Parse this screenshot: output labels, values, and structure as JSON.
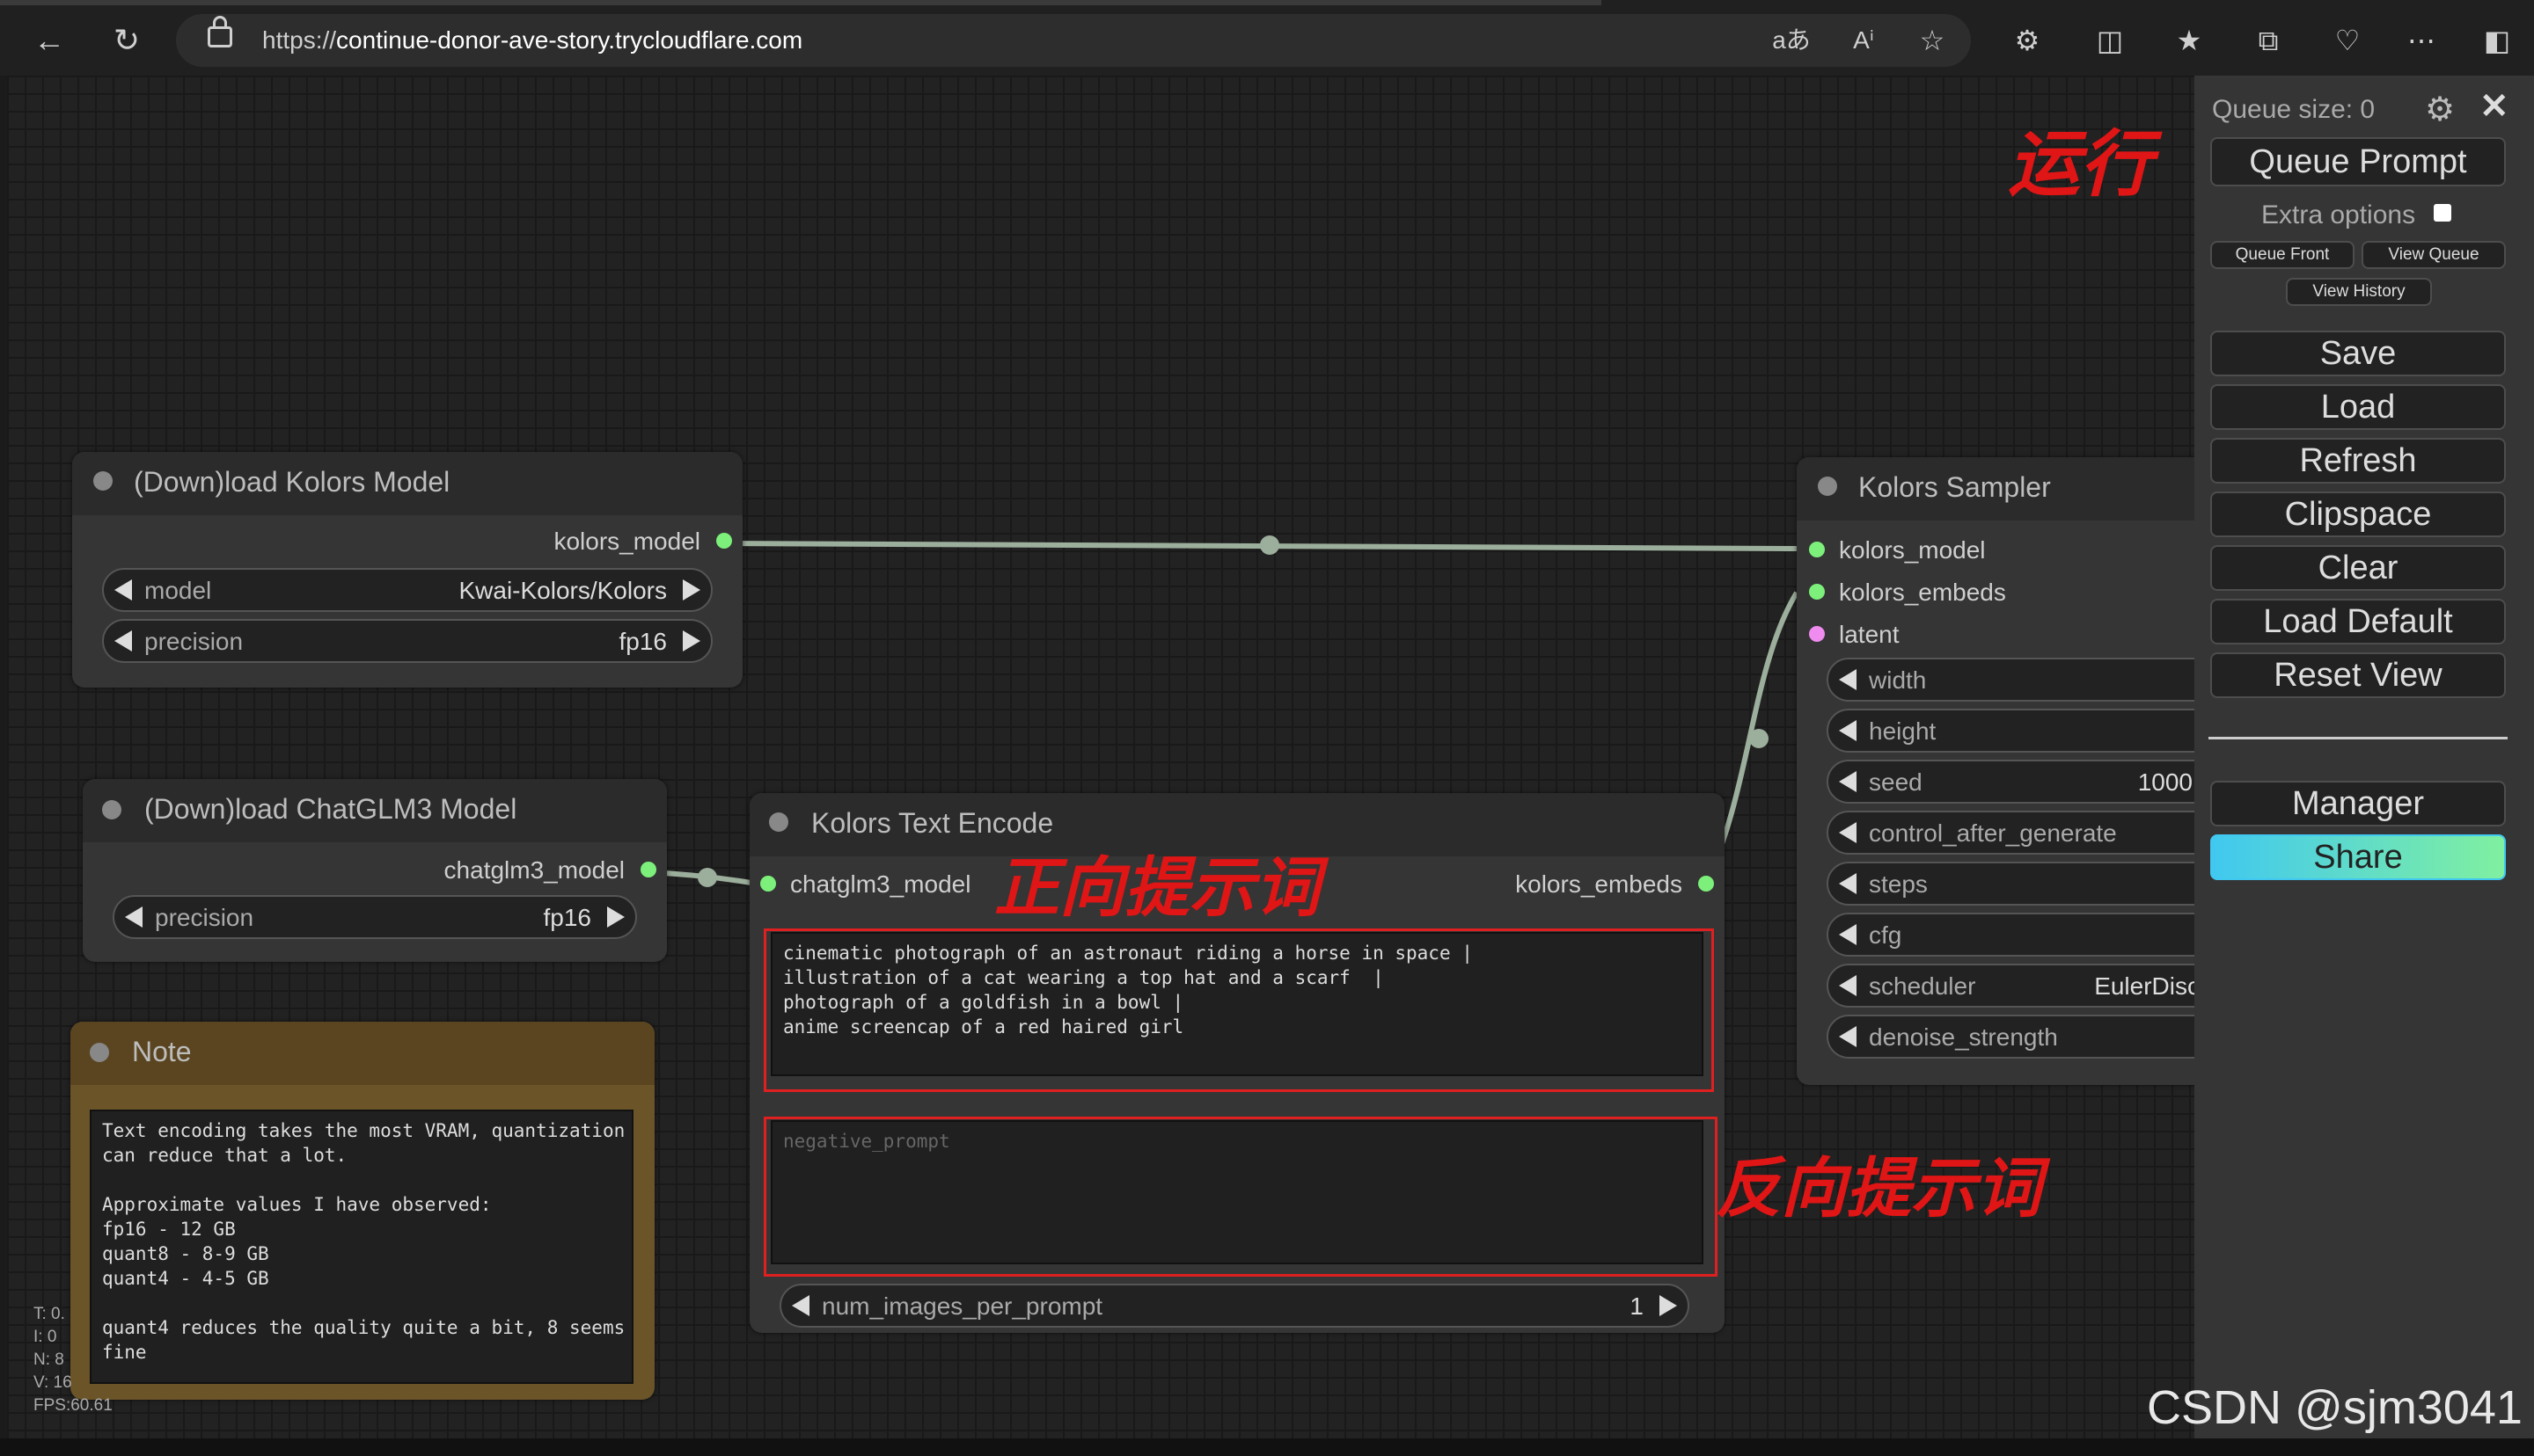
{
  "browser": {
    "url_scheme": "https://",
    "url_host": "continue-donor-ave-story.trycloudflare.com",
    "icons": [
      "back-icon",
      "refresh-icon",
      "lock-icon",
      "translate-icon",
      "read-aloud-icon",
      "favorite-star-icon",
      "extensions-icon",
      "split-screen-icon",
      "favorites-icon",
      "collections-icon",
      "health-icon",
      "more-icon",
      "sidebar-icon"
    ]
  },
  "nodes": {
    "kolors_model": {
      "title": "(Down)load Kolors Model",
      "output": "kolors_model",
      "widgets": [
        {
          "label": "model",
          "value": "Kwai-Kolors/Kolors"
        },
        {
          "label": "precision",
          "value": "fp16"
        }
      ]
    },
    "chatglm": {
      "title": "(Down)load ChatGLM3 Model",
      "output": "chatglm3_model",
      "widgets": [
        {
          "label": "precision",
          "value": "fp16"
        }
      ]
    },
    "note": {
      "title": "Note",
      "text": "Text encoding takes the most VRAM, quantization\ncan reduce that a lot.\n\nApproximate values I have observed:\nfp16 - 12 GB\nquant8 - 8-9 GB\nquant4 - 4-5 GB\n\nquant4 reduces the quality quite a bit, 8 seems\nfine"
    },
    "text_encode": {
      "title": "Kolors Text Encode",
      "input": "chatglm3_model",
      "output": "kolors_embeds",
      "prompt": "cinematic photograph of an astronaut riding a horse in space |\nillustration of a cat wearing a top hat and a scarf  |\nphotograph of a goldfish in a bowl |\nanime screencap of a red haired girl",
      "negative_placeholder": "negative_prompt",
      "widget": {
        "label": "num_images_per_prompt",
        "value": "1"
      }
    },
    "sampler": {
      "title": "Kolors Sampler",
      "inputs": [
        "kolors_model",
        "kolors_embeds",
        "latent"
      ],
      "widgets": [
        {
          "label": "width",
          "value": ""
        },
        {
          "label": "height",
          "value": ""
        },
        {
          "label": "seed",
          "value": "1000"
        },
        {
          "label": "control_after_generate",
          "value": ""
        },
        {
          "label": "steps",
          "value": ""
        },
        {
          "label": "cfg",
          "value": ""
        },
        {
          "label": "scheduler",
          "value": "EulerDisc"
        },
        {
          "label": "denoise_strength",
          "value": ""
        }
      ]
    }
  },
  "annotations": {
    "run": "运行",
    "positive": "正向提示词",
    "negative": "反向提示词"
  },
  "panel": {
    "queue_size": "Queue size: 0",
    "queue_prompt": "Queue Prompt",
    "extra_options": "Extra options",
    "queue_front": "Queue Front",
    "view_queue": "View Queue",
    "view_history": "View History",
    "buttons": [
      "Save",
      "Load",
      "Refresh",
      "Clipspace",
      "Clear",
      "Load Default",
      "Reset View"
    ],
    "manager": "Manager",
    "share": "Share"
  },
  "stats": [
    "T: 0.",
    "I: 0",
    "N: 8",
    "V: 16",
    "FPS:60.61"
  ],
  "watermark": "CSDN @sjm3041",
  "colors": {
    "link": "#9cae9c",
    "model_slot": "#7cf07a",
    "latent_slot": "#f08cf0",
    "share_gradient_start": "#40c8f0",
    "share_gradient_end": "#80f0a0",
    "annotation_red": "#e01515"
  }
}
